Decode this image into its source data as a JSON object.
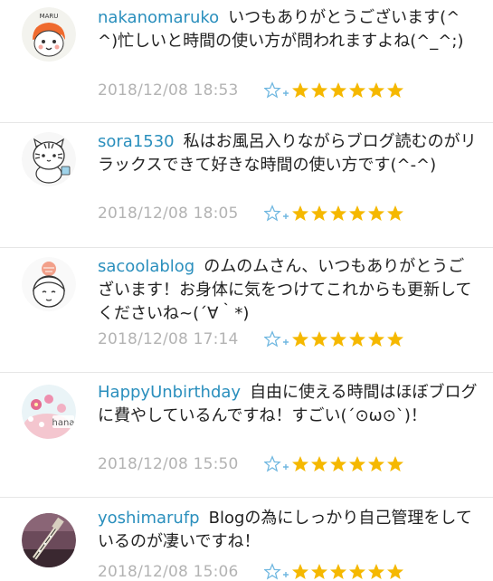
{
  "comments": [
    {
      "username": "nakanomaruko",
      "text": "いつもありがとうございます(^^)忙しいと時間の使い方が問われますよね(^_^;)",
      "date": "2018/12/08 18:53",
      "avatar_label": "MARU",
      "stars": 6
    },
    {
      "username": "sora1530",
      "text": "私はお風呂入りながらブログ読むのがリラックスできて好きな時間の使い方です(^-^)",
      "date": "2018/12/08 18:05",
      "avatar_label": "",
      "stars": 6
    },
    {
      "username": "sacoolablog",
      "text": "のムのムさん、いつもありがとうございます！お身体に気をつけてこれからも更新してくださいね~(´∀｀*)",
      "date": "2018/12/08 17:14",
      "avatar_label": "",
      "stars": 6
    },
    {
      "username": "HappyUnbirthday",
      "text": "自由に使える時間はほぼブログに費やしているんですね！すごい(´⊙ω⊙`)！",
      "date": "2018/12/08 15:50",
      "avatar_label": "hana",
      "stars": 6
    },
    {
      "username": "yoshimarufp",
      "text": "Blogの為にしっかり自己管理をしているのが凄いですね！",
      "date": "2018/12/08 15:06",
      "avatar_label": "",
      "stars": 6
    }
  ],
  "colors": {
    "username": "#2a8fbd",
    "date": "#b3b3b3",
    "star": "#f5b800",
    "star_add": "#6fb7e0"
  },
  "icons": {
    "add_star": "add-star-icon",
    "rated_star": "star-icon"
  }
}
